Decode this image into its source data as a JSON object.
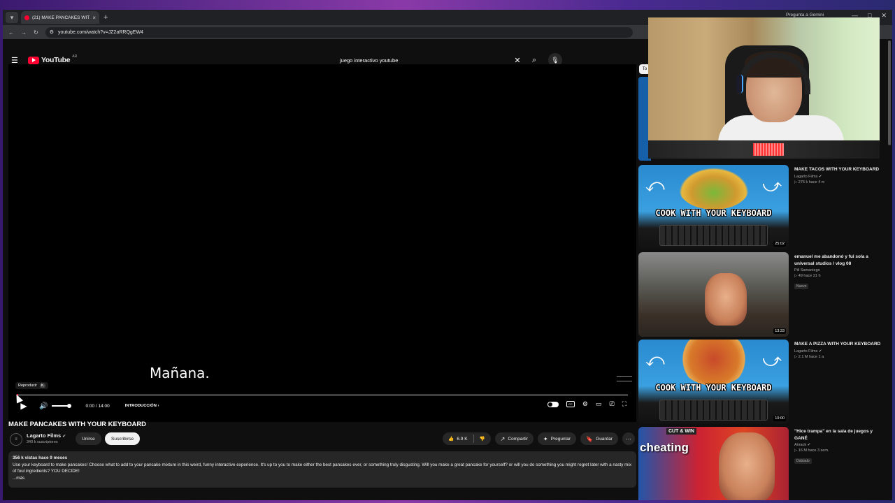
{
  "browser": {
    "tab_title": "(21) MAKE PANCAKES WITH YO",
    "tab_close": "×",
    "new_tab": "+",
    "gemini_label": "Pregunta a Gemini",
    "url": "youtube.com/watch?v=JZ2aRRQgEW4"
  },
  "header": {
    "logo_text": "YouTube",
    "logo_country": "AR",
    "search_value": "juego interactivo youtube"
  },
  "player": {
    "caption": "Mañana.",
    "tooltip_label": "Reproducir",
    "tooltip_key": "K",
    "time": "0:00 / 14:00",
    "chapter": "INTRODUCCIÓN",
    "progress_fraction": 0.0,
    "volume_fraction": 1.0
  },
  "video": {
    "title": "MAKE PANCAKES WITH YOUR KEYBOARD",
    "channel": "Lagarto Films",
    "subscribers": "340 k suscriptores",
    "join_label": "Unirse",
    "subscribe_label": "Suscribirse",
    "likes": "6.9 K",
    "share_label": "Compartir",
    "ask_label": "Preguntar",
    "save_label": "Guardar",
    "stats": "356 k vistas  hace 9 meses",
    "description": "Use your keyboard to make pancakes! Choose what to add to your pancake mixture in this weird, funny interactive experience. It's up to you to make either the best pancakes ever, or something truly disgusting. Will you make a great pancake for yourself? or will you do something you might regret later with a nasty mix of foul ingredients? YOU DECIDE!",
    "more_label": "...más"
  },
  "filters": {
    "first": "To"
  },
  "recommendations": [
    {
      "title": "MAKE TACOS WITH YOUR KEYBOARD",
      "channel": "Lagarto Films",
      "stats": "▷ 276 k  hace 4 m",
      "duration": "25:02",
      "overlay_text": "COOK WITH YOUR KEYBOARD",
      "badge": ""
    },
    {
      "title": "emanuel me abandonó y fui sola a universal studios / vlog 08",
      "channel": "Pili Samaniego",
      "stats": "▷ 49  hace 21 h",
      "duration": "13:33",
      "overlay_text": "",
      "badge": "Nuevo"
    },
    {
      "title": "MAKE A PIZZA WITH YOUR KEYBOARD",
      "channel": "Lagarto Films",
      "stats": "▷ 2.1 M  hace 1 a",
      "duration": "10:00",
      "overlay_text": "COOK WITH YOUR KEYBOARD",
      "badge": ""
    },
    {
      "title": "\"Hice trampa\" en la sala de juegos y GANÉ",
      "channel": "Airrack",
      "stats": "▷ 16 M  hace 3 sem.",
      "duration": "",
      "overlay_text": "cheating",
      "overlay_small": "CUT & WIN",
      "badge": "Doblado"
    }
  ]
}
